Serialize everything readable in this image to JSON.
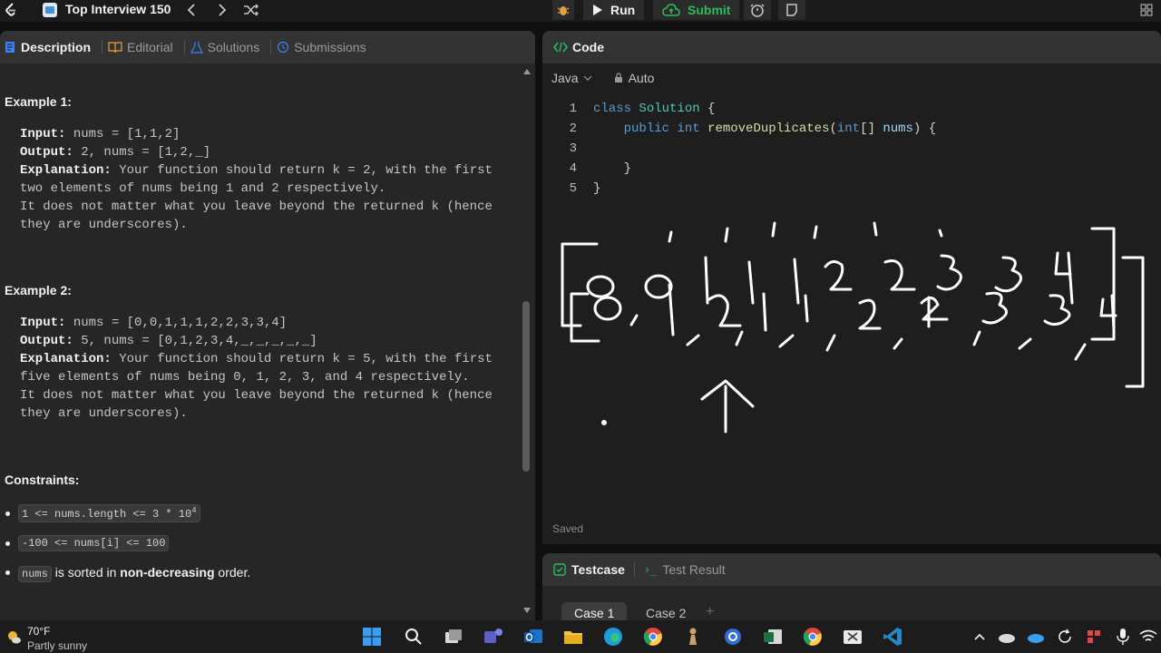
{
  "topbar": {
    "problem_list_title": "Top Interview 150",
    "run_label": "Run",
    "submit_label": "Submit"
  },
  "description_tabs": [
    {
      "label": "Description"
    },
    {
      "label": "Editorial"
    },
    {
      "label": "Solutions"
    },
    {
      "label": "Submissions"
    }
  ],
  "description": {
    "example1_heading": "Example 1:",
    "example1": {
      "input_label": "Input:",
      "input_value": " nums = [1,1,2]",
      "output_label": "Output:",
      "output_value": " 2, nums = [1,2,_]",
      "explanation_label": "Explanation:",
      "explanation_line1": " Your function should return k = 2, with the first",
      "explanation_line2": "two elements of nums being 1 and 2 respectively.",
      "explanation_line3": "It does not matter what you leave beyond the returned k (hence",
      "explanation_line4": "they are underscores)."
    },
    "example2_heading": "Example 2:",
    "example2": {
      "input_label": "Input:",
      "input_value": " nums = [0,0,1,1,1,2,2,3,3,4]",
      "output_label": "Output:",
      "output_value": " 5, nums = [0,1,2,3,4,_,_,_,_,_]",
      "explanation_label": "Explanation:",
      "explanation_line1": " Your function should return k = 5, with the first",
      "explanation_line2": "five elements of nums being 0, 1, 2, 3, and 4 respectively.",
      "explanation_line3": "It does not matter what you leave beyond the returned k (hence",
      "explanation_line4": "they are underscores)."
    },
    "constraints_heading": "Constraints:",
    "constraint1_main": "1 <= nums.length <= 3 * 10",
    "constraint1_sup": "4",
    "constraint2": "-100 <= nums[i] <= 100",
    "constraint3_code": "nums",
    "constraint3_mid": " is sorted in ",
    "constraint3_bold": "non-decreasing",
    "constraint3_end": " order."
  },
  "code_panel": {
    "title": "Code",
    "language": "Java",
    "mode": "Auto",
    "lines": [
      {
        "num": "1",
        "kw": "class",
        "name": " Solution",
        "rest": " {"
      },
      {
        "num": "2",
        "indent": "    ",
        "kw": "public",
        "ty": " int",
        "fn": " removeDuplicates",
        "p1": "(",
        "ty2": "int",
        "p2": "[] ",
        "var": "nums",
        "p3": ") {"
      },
      {
        "num": "3"
      },
      {
        "num": "4",
        "text": "    }"
      },
      {
        "num": "5",
        "text": "}"
      }
    ],
    "saved_label": "Saved"
  },
  "test_panel": {
    "testcase_tab": "Testcase",
    "test_result_tab": "Test Result",
    "case1": "Case 1",
    "case2": "Case 2",
    "add_label": "+"
  },
  "taskbar": {
    "weather_temp": "70°F",
    "weather_desc": "Partly sunny"
  },
  "colors": {
    "accent_green": "#2cbb5d",
    "keyword_blue": "#569cd6",
    "function_yellow": "#dcdcaa",
    "type_teal": "#4ec9b0",
    "variable_lightblue": "#9cdcfe"
  }
}
